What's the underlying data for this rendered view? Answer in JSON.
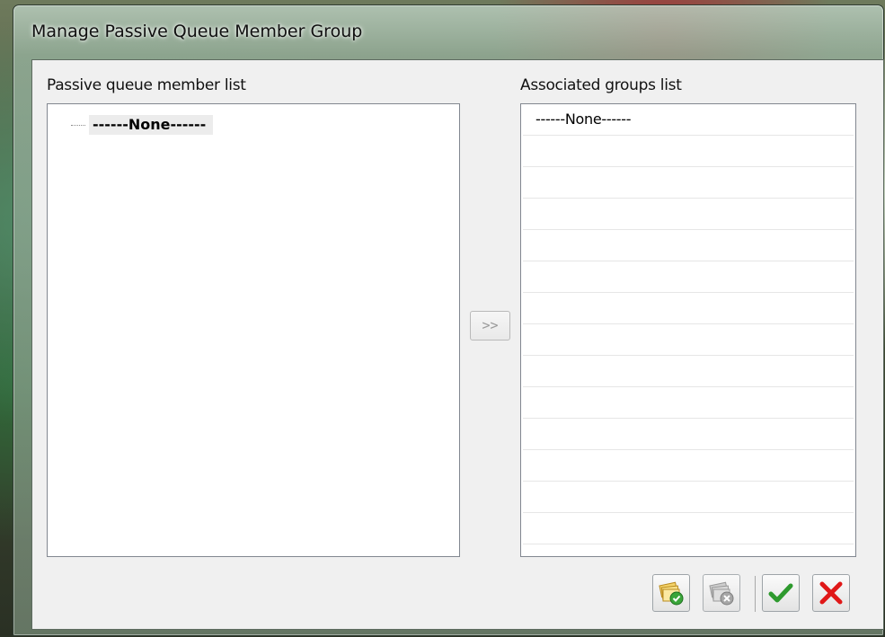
{
  "window": {
    "title": "Manage Passive Queue Member Group"
  },
  "left_panel": {
    "label": "Passive queue member list",
    "tree_items": [
      {
        "text": "------None------"
      }
    ]
  },
  "move_button": {
    "label": ">>"
  },
  "right_panel": {
    "label": "Associated groups list",
    "rows": [
      "------None------",
      "",
      "",
      "",
      "",
      "",
      "",
      "",
      "",
      "",
      "",
      "",
      "",
      ""
    ]
  },
  "toolbar": {
    "buttons": [
      {
        "icon": "assign-group-icon",
        "enabled": true
      },
      {
        "icon": "remove-group-icon",
        "enabled": false
      },
      {
        "icon": "confirm-check-icon",
        "enabled": true,
        "color": "#2e9a2e"
      },
      {
        "icon": "cancel-x-icon",
        "enabled": true,
        "color": "#e01818"
      }
    ]
  }
}
